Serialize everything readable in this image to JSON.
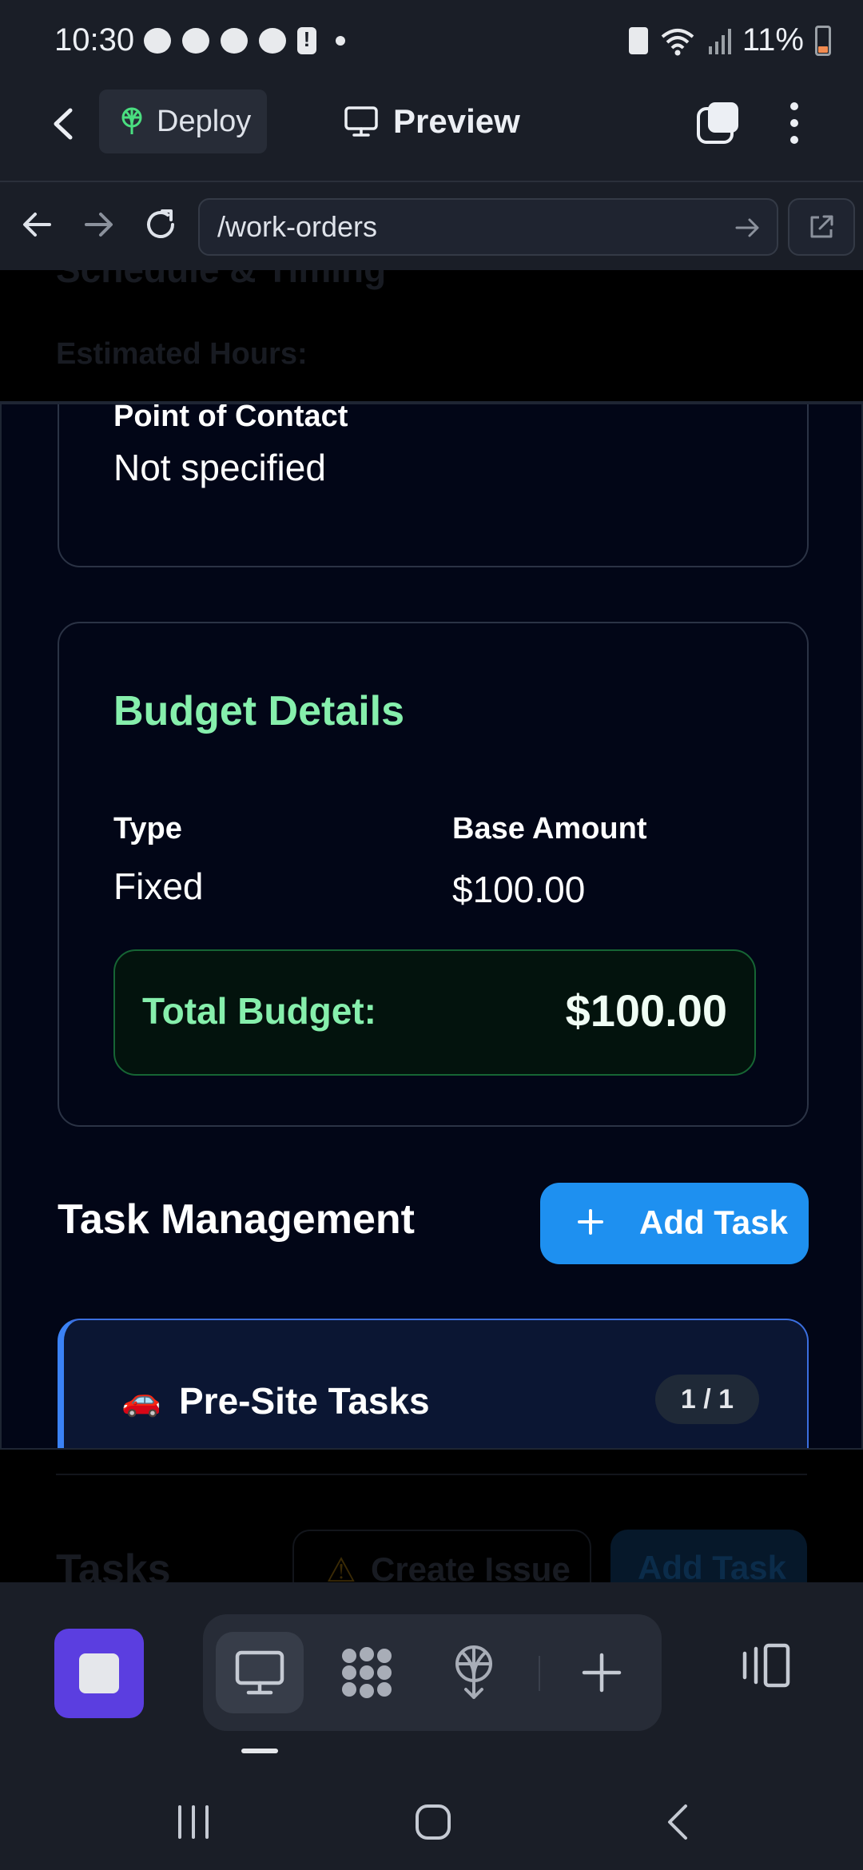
{
  "status_bar": {
    "time": "10:30",
    "battery_percent": "11%",
    "notification_icons": [
      "chat-bubble-icon",
      "messenger-icon",
      "messenger-icon",
      "messenger-icon",
      "alert-icon",
      "dot-icon"
    ]
  },
  "toolbar": {
    "deploy_label": "Deploy",
    "preview_label": "Preview"
  },
  "url_bar": {
    "path": "/work-orders"
  },
  "ghost_top": {
    "heading": "Schedule & Timing",
    "label": "Estimated Hours:"
  },
  "contact": {
    "label": "Point of Contact",
    "value": "Not specified"
  },
  "budget": {
    "title": "Budget Details",
    "type_label": "Type",
    "type_value": "Fixed",
    "base_label": "Base Amount",
    "base_value": "$100.00",
    "total_label": "Total Budget:",
    "total_value": "$100.00"
  },
  "tasks": {
    "heading": "Task Management",
    "add_label": "Add Task",
    "group_icon": "🚗",
    "group_title": "Pre-Site Tasks",
    "group_count": "1 / 1"
  },
  "ghost_bottom": {
    "tasks_label": "Tasks",
    "issue_icon": "⚠",
    "issue_label": "Create Issue",
    "add_label": "Add Task"
  },
  "colors": {
    "accent_green": "#86efac",
    "accent_blue": "#1e90f0",
    "stop_purple": "#5b3ee0",
    "background": "#020617"
  }
}
